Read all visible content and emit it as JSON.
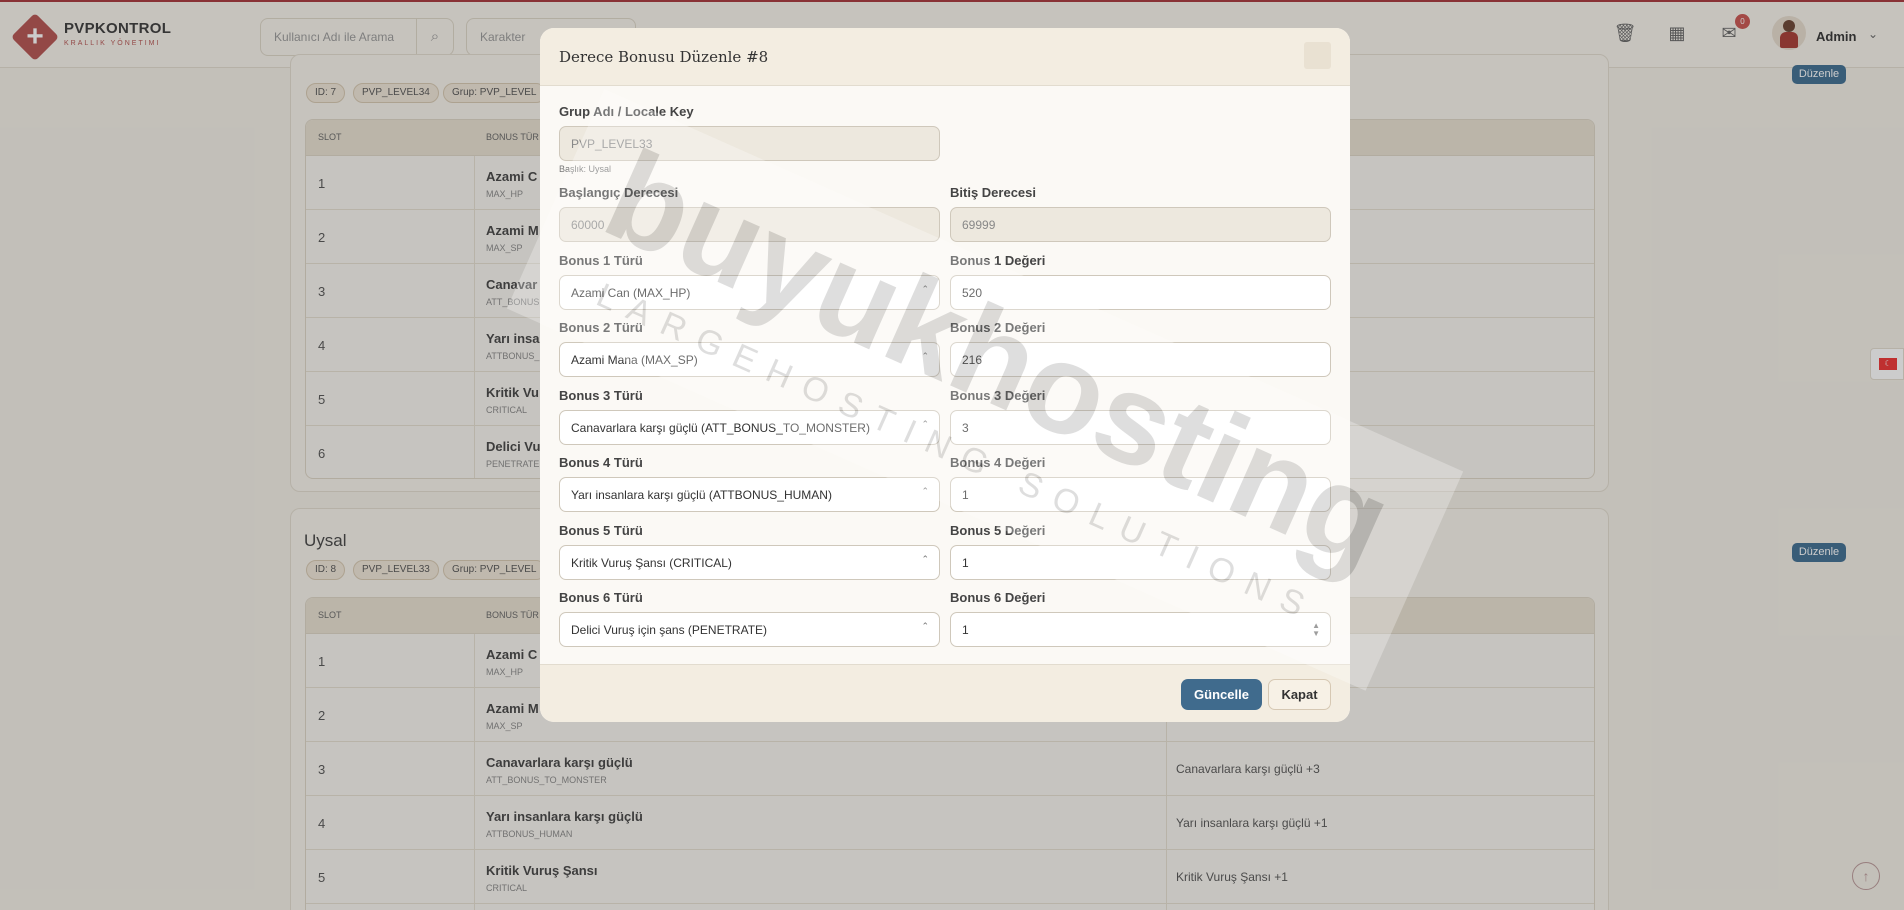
{
  "app": {
    "brand_title": "PVPKONTROL",
    "brand_subtitle": "KRALLIK YÖNETIMI",
    "user_name": "Admin",
    "notification_count": "0"
  },
  "search": {
    "user_placeholder": "Kullanıcı Adı ile Arama",
    "character_placeholder": "Karakter"
  },
  "cards": [
    {
      "id_label": "ID: 7",
      "level_key": "PVP_LEVEL34",
      "group_label": "Grup: PVP_LEVEL",
      "edit_label": "Düzenle",
      "rows": [
        {
          "slot": "1",
          "name": "Azami C",
          "code": "MAX_HP"
        },
        {
          "slot": "2",
          "name": "Azami M",
          "code": "MAX_SP"
        },
        {
          "slot": "3",
          "name": "Canavar",
          "code": "ATT_BONUS"
        },
        {
          "slot": "4",
          "name": "Yarı insan",
          "code": "ATTBONUS_"
        },
        {
          "slot": "5",
          "name": "Kritik Vu",
          "code": "CRITICAL"
        },
        {
          "slot": "6",
          "name": "Delici Vu",
          "code": "PENETRATE"
        }
      ]
    },
    {
      "title": "Uysal",
      "id_label": "ID: 8",
      "level_key": "PVP_LEVEL33",
      "group_label": "Grup: PVP_LEVEL",
      "edit_label": "Düzenle",
      "rows": [
        {
          "slot": "1",
          "name": "Azami C",
          "code": "MAX_HP",
          "value": ""
        },
        {
          "slot": "2",
          "name": "Azami M",
          "code": "MAX_SP",
          "value": ""
        },
        {
          "slot": "3",
          "name": "Canavarlara karşı güçlü",
          "code": "ATT_BONUS_TO_MONSTER",
          "value": "Canavarlara karşı güçlü +3"
        },
        {
          "slot": "4",
          "name": "Yarı insanlara karşı güçlü",
          "code": "ATTBONUS_HUMAN",
          "value": "Yarı insanlara karşı güçlü +1"
        },
        {
          "slot": "5",
          "name": "Kritik Vuruş Şansı",
          "code": "CRITICAL",
          "value": "Kritik Vuruş Şansı +1"
        }
      ]
    }
  ],
  "table_headers": {
    "slot": "SLOT",
    "bonus": "BONUS TÜR"
  },
  "modal": {
    "title": "Derece Bonusu Düzenle #8",
    "group_label": "Grup Adı / Locale Key",
    "group_value": "PVP_LEVEL33",
    "group_help": "Başlık: Uysal",
    "start_label": "Başlangıç Derecesi",
    "start_value": "60000",
    "end_label": "Bitiş Derecesi",
    "end_value": "69999",
    "bonuses": [
      {
        "type_label": "Bonus 1 Türü",
        "type_value": "Azami Can (MAX_HP)",
        "value_label": "Bonus 1 Değeri",
        "value": "520"
      },
      {
        "type_label": "Bonus 2 Türü",
        "type_value": "Azami Mana (MAX_SP)",
        "value_label": "Bonus 2 Değeri",
        "value": "216"
      },
      {
        "type_label": "Bonus 3 Türü",
        "type_value": "Canavarlara karşı güçlü (ATT_BONUS_TO_MONSTER)",
        "value_label": "Bonus 3 Değeri",
        "value": "3"
      },
      {
        "type_label": "Bonus 4 Türü",
        "type_value": "Yarı insanlara karşı güçlü (ATTBONUS_HUMAN)",
        "value_label": "Bonus 4 Değeri",
        "value": "1"
      },
      {
        "type_label": "Bonus 5 Türü",
        "type_value": "Kritik Vuruş Şansı (CRITICAL)",
        "value_label": "Bonus 5 Değeri",
        "value": "1"
      },
      {
        "type_label": "Bonus 6 Türü",
        "type_value": "Delici Vuruş için şans (PENETRATE)",
        "value_label": "Bonus 6 Değeri",
        "value": "1"
      }
    ],
    "update_label": "Güncelle",
    "close_label": "Kapat"
  },
  "watermark": {
    "main": "buyukhosting",
    "sub": "LARGEHOSTING SOLUTIONS"
  },
  "colors": {
    "accent": "#406b8d",
    "brand": "#b5524f",
    "background": "#f3efe6"
  }
}
